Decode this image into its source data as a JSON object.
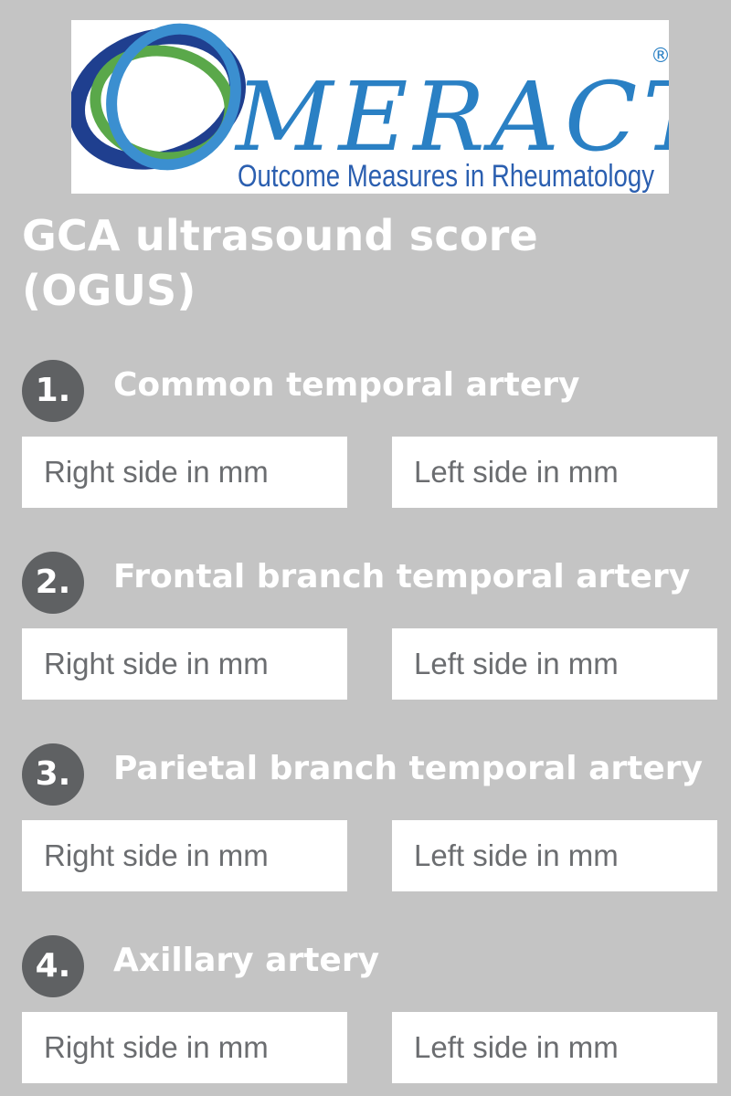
{
  "logo": {
    "brand": "MERACT",
    "registered": "®",
    "tagline": "Outcome Measures in Rheumatology"
  },
  "title": "GCA ultrasound score (OGUS)",
  "sections": [
    {
      "number": "1.",
      "title": "Common temporal artery",
      "right": {
        "value": "",
        "placeholder": "Right side in mm"
      },
      "left": {
        "value": "",
        "placeholder": "Left side in mm"
      }
    },
    {
      "number": "2.",
      "title": "Frontal branch temporal artery",
      "right": {
        "value": "",
        "placeholder": "Right side in mm"
      },
      "left": {
        "value": "",
        "placeholder": "Left side in mm"
      }
    },
    {
      "number": "3.",
      "title": "Parietal branch temporal artery",
      "right": {
        "value": "",
        "placeholder": "Right side in mm"
      },
      "left": {
        "value": "",
        "placeholder": "Left side in mm"
      }
    },
    {
      "number": "4.",
      "title": "Axillary artery",
      "right": {
        "value": "",
        "placeholder": "Right side in mm"
      },
      "left": {
        "value": "",
        "placeholder": "Left side in mm"
      }
    }
  ],
  "colors": {
    "background": "#c4c4c4",
    "badge": "#5f6163",
    "logo_dark_blue": "#1f3f8f",
    "logo_green": "#5aa84a",
    "logo_light_blue": "#3b8fd0"
  }
}
